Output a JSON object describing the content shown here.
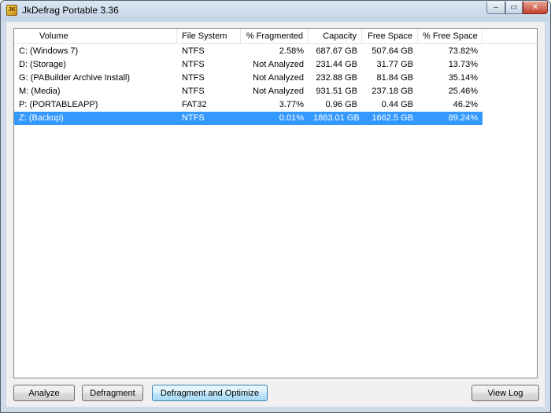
{
  "window": {
    "title": "JkDefrag Portable 3.36",
    "icon_text": "JK"
  },
  "controls": {
    "minimize": "–",
    "maximize": "▭",
    "close": "✕"
  },
  "table": {
    "columns": [
      "Volume",
      "File System",
      "% Fragmented",
      "Capacity",
      "Free Space",
      "% Free Space"
    ],
    "rows": [
      {
        "volume": "C: (Windows 7)",
        "fs": "NTFS",
        "frag": "2.58%",
        "capacity": "687.67 GB",
        "free": "507.64 GB",
        "pct_free": "73.82%"
      },
      {
        "volume": "D: (Storage)",
        "fs": "NTFS",
        "frag": "Not Analyzed",
        "capacity": "231.44 GB",
        "free": "31.77 GB",
        "pct_free": "13.73%"
      },
      {
        "volume": "G: (PABuilder Archive Install)",
        "fs": "NTFS",
        "frag": "Not Analyzed",
        "capacity": "232.88 GB",
        "free": "81.84 GB",
        "pct_free": "35.14%"
      },
      {
        "volume": "M: (Media)",
        "fs": "NTFS",
        "frag": "Not Analyzed",
        "capacity": "931.51 GB",
        "free": "237.18 GB",
        "pct_free": "25.46%"
      },
      {
        "volume": "P: (PORTABLEAPP)",
        "fs": "FAT32",
        "frag": "3.77%",
        "capacity": "0.96 GB",
        "free": "0.44 GB",
        "pct_free": "46.2%"
      },
      {
        "volume": "Z: (Backup)",
        "fs": "NTFS",
        "frag": "0.01%",
        "capacity": "1863.01 GB",
        "free": "1662.5 GB",
        "pct_free": "89.24%"
      }
    ],
    "selected_row": 5
  },
  "buttons": {
    "analyze": "Analyze",
    "defragment": "Defragment",
    "defrag_optimize": "Defragment and Optimize",
    "view_log": "View Log"
  },
  "colors": {
    "selection": "#3399ff",
    "window_frame": "#cfdbe9"
  }
}
